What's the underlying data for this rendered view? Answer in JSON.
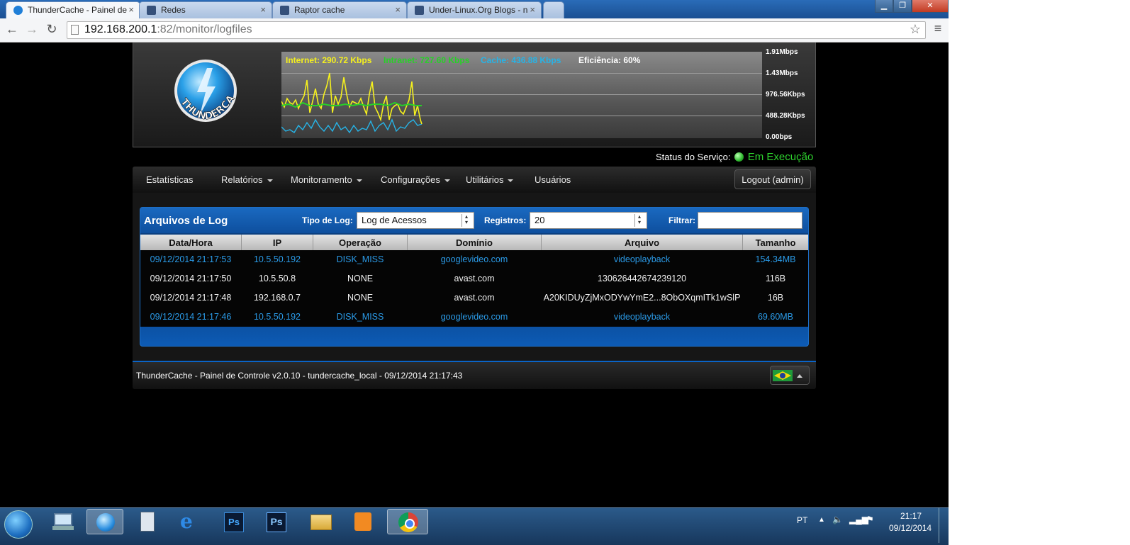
{
  "browser": {
    "tabs": [
      {
        "label": "ThunderCache - Painel de",
        "active": true
      },
      {
        "label": "Redes",
        "active": false
      },
      {
        "label": "Raptor cache",
        "active": false
      },
      {
        "label": "Under-Linux.Org Blogs - n",
        "active": false
      }
    ],
    "url_host": "192.168.200.1",
    "url_rest": ":82/monitor/logfiles"
  },
  "header": {
    "logo_text": "THUNDERCACHE",
    "legend": {
      "internet": "Internet: 290.72 Kbps",
      "intranet": "Intranet: 727.60 Kbps",
      "cache": "Cache: 436.88 Kbps",
      "efficiency": "Eficiência: 60%"
    },
    "y_labels": [
      "1.91Mbps",
      "1.43Mbps",
      "976.56Kbps",
      "488.28Kbps",
      "0.00bps"
    ],
    "colors": {
      "internet": "#f5f01e",
      "intranet": "#27d127",
      "cache": "#27b3e6"
    }
  },
  "status": {
    "label": "Status do Serviço:",
    "value": "Em Execução"
  },
  "menu": {
    "items": [
      "Estatísticas",
      "Relatórios",
      "Monitoramento",
      "Configurações",
      "Utilitários",
      "Usuários"
    ],
    "logout": "Logout (admin)"
  },
  "panel": {
    "title": "Arquivos de Log",
    "log_type_label": "Tipo de Log:",
    "log_type_value": "Log de Acessos",
    "records_label": "Registros:",
    "records_value": "20",
    "filter_label": "Filtrar:",
    "filter_value": ""
  },
  "table": {
    "columns": [
      "Data/Hora",
      "IP",
      "Operação",
      "Domínio",
      "Arquivo",
      "Tamanho"
    ],
    "rows": [
      [
        "09/12/2014 21:17:53",
        "10.5.50.192",
        "DISK_MISS",
        "googlevideo.com",
        "videoplayback",
        "154.34MB"
      ],
      [
        "09/12/2014 21:17:50",
        "10.5.50.8",
        "NONE",
        "avast.com",
        "130626442674239120",
        "116B"
      ],
      [
        "09/12/2014 21:17:48",
        "192.168.0.7",
        "NONE",
        "avast.com",
        "A20KIDUyZjMxODYwYmE2...8ObOXqmITk1wSlP",
        "16B"
      ],
      [
        "09/12/2014 21:17:46",
        "10.5.50.192",
        "DISK_MISS",
        "googlevideo.com",
        "videoplayback",
        "69.60MB"
      ]
    ]
  },
  "footer": {
    "text": "ThunderCache - Painel de Controle v2.0.10 - tundercache_local - 09/12/2014 21:17:43"
  },
  "taskbar": {
    "lang": "PT",
    "time": "21:17",
    "date": "09/12/2014"
  }
}
